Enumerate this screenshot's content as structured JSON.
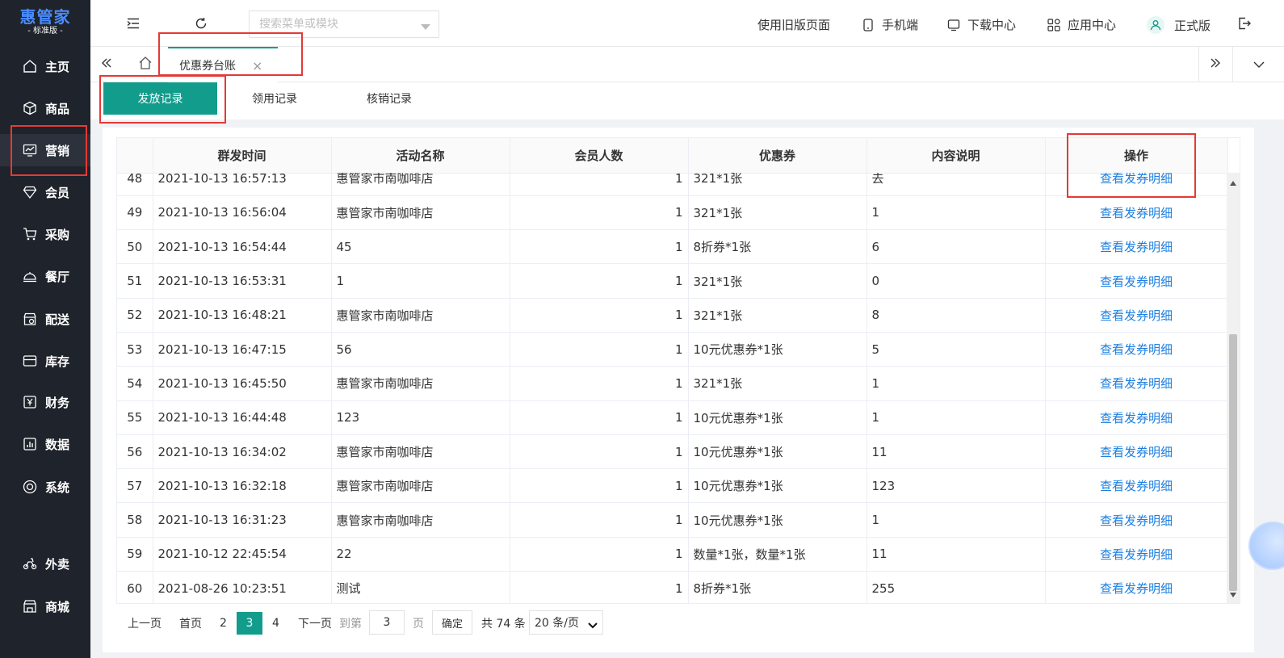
{
  "brand": {
    "name": "惠管家",
    "edition": "- 标准版 -",
    "color": "#4a8cff"
  },
  "sidebar": {
    "items": [
      {
        "label": "主页",
        "icon": "home-icon"
      },
      {
        "label": "商品",
        "icon": "cube-icon"
      },
      {
        "label": "营销",
        "icon": "monitor-chart-icon",
        "active": true
      },
      {
        "label": "会员",
        "icon": "diamond-icon"
      },
      {
        "label": "采购",
        "icon": "cart-icon"
      },
      {
        "label": "餐厅",
        "icon": "cloche-icon"
      },
      {
        "label": "配送",
        "icon": "store-icon"
      },
      {
        "label": "库存",
        "icon": "inbox-icon"
      },
      {
        "label": "财务",
        "icon": "yen-icon"
      },
      {
        "label": "数据",
        "icon": "bar-chart-icon"
      },
      {
        "label": "系统",
        "icon": "target-icon"
      },
      {
        "label": "外卖",
        "icon": "scooter-icon"
      },
      {
        "label": "商城",
        "icon": "shop-icon"
      }
    ]
  },
  "header": {
    "search_placeholder": "搜索菜单或模块",
    "links": {
      "old_version": "使用旧版页面",
      "mobile": "手机端",
      "download": "下载中心",
      "apps": "应用中心",
      "account": "正式版"
    }
  },
  "tabs": {
    "current": "优惠券台账",
    "close": "×"
  },
  "subtabs": {
    "issue": "发放记录",
    "claim": "领用记录",
    "redeem": "核销记录"
  },
  "table": {
    "columns": [
      "",
      "群发时间",
      "活动名称",
      "会员人数",
      "优惠券",
      "内容说明",
      "操作"
    ],
    "rows": [
      {
        "no": "48",
        "time": "2021-10-13 16:57:13",
        "name": "惠管家市南咖啡店",
        "count": "1",
        "coupon": "321*1张",
        "desc": "去",
        "op": "查看发券明细"
      },
      {
        "no": "49",
        "time": "2021-10-13 16:56:04",
        "name": "惠管家市南咖啡店",
        "count": "1",
        "coupon": "321*1张",
        "desc": "1",
        "op": "查看发券明细"
      },
      {
        "no": "50",
        "time": "2021-10-13 16:54:44",
        "name": "45",
        "count": "1",
        "coupon": "8折券*1张",
        "desc": "6",
        "op": "查看发券明细"
      },
      {
        "no": "51",
        "time": "2021-10-13 16:53:31",
        "name": "1",
        "count": "1",
        "coupon": "321*1张",
        "desc": "0",
        "op": "查看发券明细"
      },
      {
        "no": "52",
        "time": "2021-10-13 16:48:21",
        "name": "惠管家市南咖啡店",
        "count": "1",
        "coupon": "321*1张",
        "desc": "8",
        "op": "查看发券明细"
      },
      {
        "no": "53",
        "time": "2021-10-13 16:47:15",
        "name": "56",
        "count": "1",
        "coupon": "10元优惠券*1张",
        "desc": "5",
        "op": "查看发券明细"
      },
      {
        "no": "54",
        "time": "2021-10-13 16:45:50",
        "name": "惠管家市南咖啡店",
        "count": "1",
        "coupon": "321*1张",
        "desc": "1",
        "op": "查看发券明细"
      },
      {
        "no": "55",
        "time": "2021-10-13 16:44:48",
        "name": "123",
        "count": "1",
        "coupon": "10元优惠券*1张",
        "desc": "1",
        "op": "查看发券明细"
      },
      {
        "no": "56",
        "time": "2021-10-13 16:34:02",
        "name": "惠管家市南咖啡店",
        "count": "1",
        "coupon": "10元优惠券*1张",
        "desc": "11",
        "op": "查看发券明细"
      },
      {
        "no": "57",
        "time": "2021-10-13 16:32:18",
        "name": "惠管家市南咖啡店",
        "count": "1",
        "coupon": "10元优惠券*1张",
        "desc": "123",
        "op": "查看发券明细"
      },
      {
        "no": "58",
        "time": "2021-10-13 16:31:23",
        "name": "惠管家市南咖啡店",
        "count": "1",
        "coupon": "10元优惠券*1张",
        "desc": "1",
        "op": "查看发券明细"
      },
      {
        "no": "59",
        "time": "2021-10-12 22:45:54",
        "name": "22",
        "count": "1",
        "coupon": "数量*1张，数量*1张",
        "desc": "11",
        "op": "查看发券明细"
      },
      {
        "no": "60",
        "time": "2021-08-26 10:23:51",
        "name": "测试",
        "count": "1",
        "coupon": "8折券*1张",
        "desc": "255",
        "op": "查看发券明细"
      }
    ]
  },
  "pagination": {
    "prev": "上一页",
    "first": "首页",
    "pages": [
      "2",
      "3",
      "4"
    ],
    "current": "3",
    "next": "下一页",
    "goto_label": "到第",
    "goto_value": "3",
    "page_unit": "页",
    "confirm": "确定",
    "total": "共 74 条",
    "page_size": "20 条/页"
  },
  "colors": {
    "accent": "#129c8c",
    "link": "#1d7fe0",
    "sidebar_bg": "#1f232b",
    "annotation": "#e53935"
  }
}
